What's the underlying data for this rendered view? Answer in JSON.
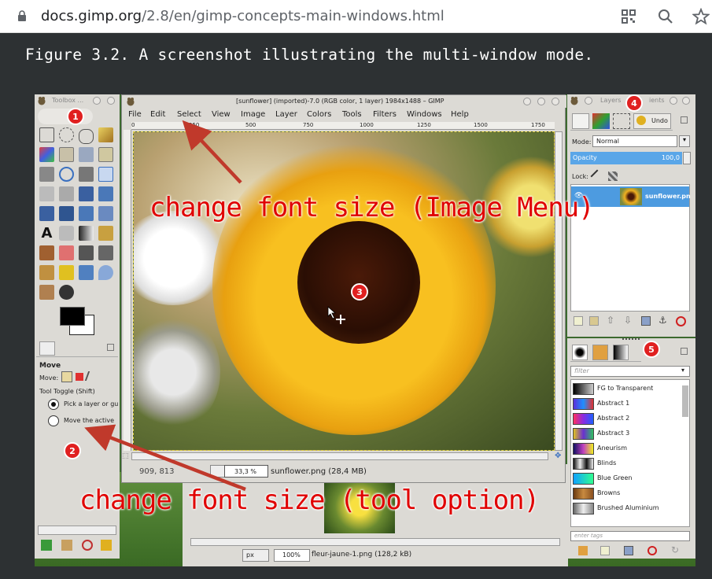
{
  "browser": {
    "url_host": "docs.gimp.org",
    "url_path": "/2.8/en/gimp-concepts-main-windows.html"
  },
  "figure": {
    "caption": "Figure 3.2.  A screenshot illustrating the multi-window mode."
  },
  "toolbox": {
    "title": "Toolbox ...",
    "tool_options_title": "Move",
    "move_label": "Move:",
    "tool_toggle": "Tool Toggle  (Shift)",
    "option1": "Pick a layer or gu",
    "option2": "Move the active"
  },
  "image_window": {
    "title": "[sunflower] (imported)-7.0 (RGB color, 1 layer) 1984x1488 – GIMP",
    "menu": [
      "File",
      "Edit",
      "Select",
      "View",
      "Image",
      "Layer",
      "Colors",
      "Tools",
      "Filters",
      "Windows",
      "Help"
    ],
    "ruler": [
      "0",
      "250",
      "500",
      "750",
      "1000",
      "1250",
      "1500",
      "1750"
    ],
    "coords": "909, 813",
    "zoom": "33,3 %",
    "file_info": "sunflower.png (28,4 MB)"
  },
  "second_window": {
    "unit": "px",
    "zoom": "100%",
    "file_info": "fleur-jaune-1.png (128,2 kB)"
  },
  "layers_dock": {
    "title": "Layers",
    "title_suffix": "ients",
    "undo_tab": "Undo",
    "mode_label": "Mode:",
    "mode_value": "Normal",
    "opacity_label": "Opacity",
    "opacity_value": "100,0",
    "lock_label": "Lock:",
    "layer_name": "sunflower.pn"
  },
  "gradients_dock": {
    "filter_placeholder": "filter",
    "tags_placeholder": "enter tags",
    "items": [
      "FG to Transparent",
      "Abstract 1",
      "Abstract 2",
      "Abstract 3",
      "Aneurism",
      "Blinds",
      "Blue Green",
      "Browns",
      "Brushed Aluminium"
    ],
    "swatches": [
      "linear-gradient(90deg,#000,#ccc)",
      "linear-gradient(90deg,#5b2fd8,#1e90ff,#e03030)",
      "linear-gradient(90deg,#ff3060,#8a2be2,#2060ff)",
      "linear-gradient(90deg,#e0c020,#6a2fd0,#30c060)",
      "linear-gradient(90deg,#101060,#c040c0,#f0f020)",
      "linear-gradient(90deg,#111,#eee,#111,#eee)",
      "linear-gradient(90deg,#10a0ff,#30ff90)",
      "linear-gradient(90deg,#6a3a10,#c88a40,#8a5020)",
      "linear-gradient(90deg,#666,#eee,#888)"
    ]
  },
  "annotations": {
    "markers": [
      "1",
      "2",
      "3",
      "4",
      "5"
    ],
    "callout_top": "change font size (Image Menu)",
    "callout_bottom": "change font size (tool option)"
  },
  "colors": {
    "page_bg": "#2d3133",
    "panel_bg": "#dcdad5",
    "accent_red": "#e00000",
    "opacity_bar": "#5aa6e8",
    "layer_selected": "#4d9be0"
  }
}
